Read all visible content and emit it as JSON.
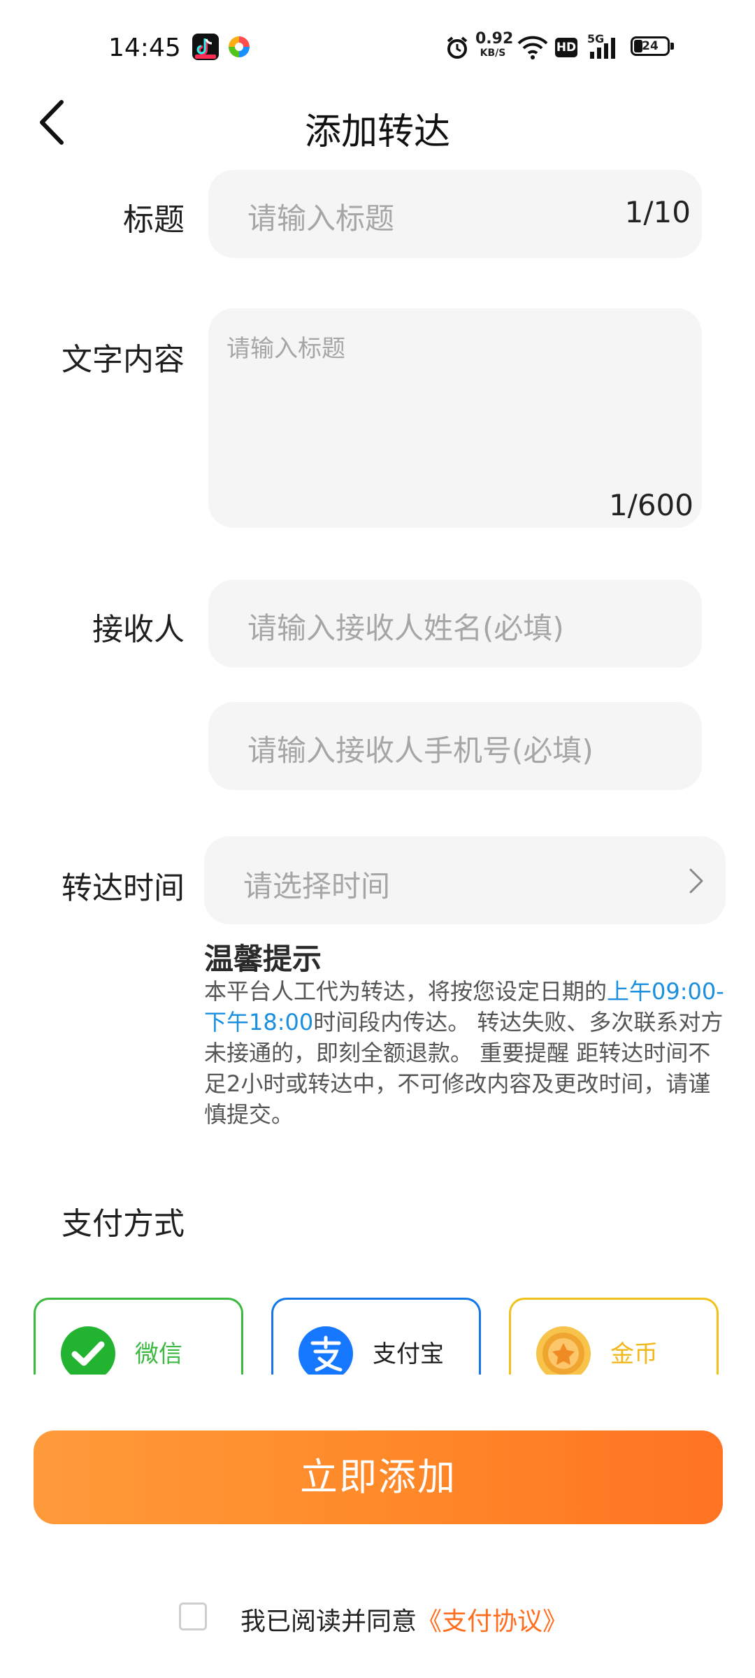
{
  "status_bar": {
    "time": "14:45",
    "net_speed_value": "0.92",
    "net_speed_unit": "KB/S",
    "hd": "HD",
    "signal": "5G",
    "battery": "24",
    "icons": [
      "tiktok-icon",
      "colorful-app-icon",
      "alarm-icon",
      "wifi-icon",
      "hd-icon",
      "signal-icon",
      "battery-icon"
    ]
  },
  "header": {
    "title": "添加转达",
    "back_icon": "chevron-left-icon"
  },
  "form": {
    "title_label": "标题",
    "title_placeholder": "请输入标题",
    "title_counter": "1/10",
    "content_label": "文字内容",
    "content_placeholder": "请输入标题",
    "content_counter": "1/600",
    "receiver_label": "接收人",
    "receiver_name_placeholder": "请输入接收人姓名(必填)",
    "receiver_phone_placeholder": "请输入接收人手机号(必填)",
    "time_label": "转达时间",
    "time_placeholder": "请选择时间"
  },
  "tip": {
    "title": "温馨提示",
    "text_before": "本平台人工代为转达，将按您设定日期的",
    "highlight": "上午09:00-下午18:00",
    "text_after": "时间段内传达。 转达失败、多次联系对方未接通的，即刻全额退款。 重要提醒 距转达时间不足2小时或转达中，不可修改内容及更改时间，请谨慎提交。"
  },
  "payment": {
    "label": "支付方式",
    "options": [
      {
        "label": "微信",
        "icon": "wechat-icon",
        "color": "#3cb93f"
      },
      {
        "label": "支付宝",
        "icon": "alipay-icon",
        "color": "#1677e6"
      },
      {
        "label": "金币",
        "icon": "gold-coin-icon",
        "color": "#f1b81c"
      }
    ]
  },
  "submit_label": "立即添加",
  "agreement": {
    "text": "我已阅读并同意",
    "link": "《支付协议》"
  },
  "colors": {
    "accent": "#ff7a22",
    "link": "#1a8fe0",
    "field_bg": "#f5f5f5"
  }
}
